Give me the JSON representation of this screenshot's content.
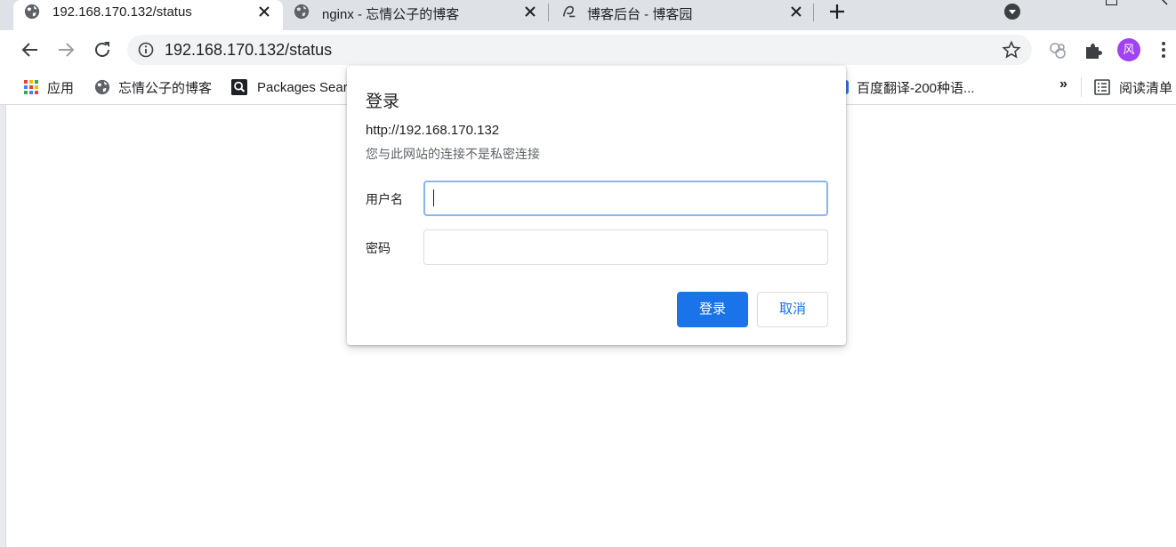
{
  "colors": {
    "accent": "#1a73e8",
    "avatar": "#a142f4",
    "tabstrip": "#dee1e6"
  },
  "tabs": [
    {
      "title": "192.168.170.132/status",
      "icon": "globe-icon",
      "active": true
    },
    {
      "title": "nginx - 忘情公子的博客",
      "icon": "globe-icon",
      "active": false
    },
    {
      "title": "博客后台 - 博客园",
      "icon": "cnblogs-icon",
      "active": false
    }
  ],
  "toolbar": {
    "url": "192.168.170.132/status",
    "avatar_letter": "风"
  },
  "bookmarks": {
    "items": [
      {
        "label": "应用",
        "icon": "apps-grid-icon"
      },
      {
        "label": "忘情公子的博客",
        "icon": "globe-icon"
      },
      {
        "label": "Packages Sear",
        "icon": "search-icon"
      },
      {
        "label": "百度翻译-200种语...",
        "icon": "baidu-translate-icon"
      }
    ],
    "overflow": "»",
    "reading_list": "阅读清单"
  },
  "dialog": {
    "title": "登录",
    "origin": "http://192.168.170.132",
    "warning": "您与此网站的连接不是私密连接",
    "username_label": "用户名",
    "username_value": "",
    "password_label": "密码",
    "password_value": "",
    "login_label": "登录",
    "cancel_label": "取消"
  }
}
